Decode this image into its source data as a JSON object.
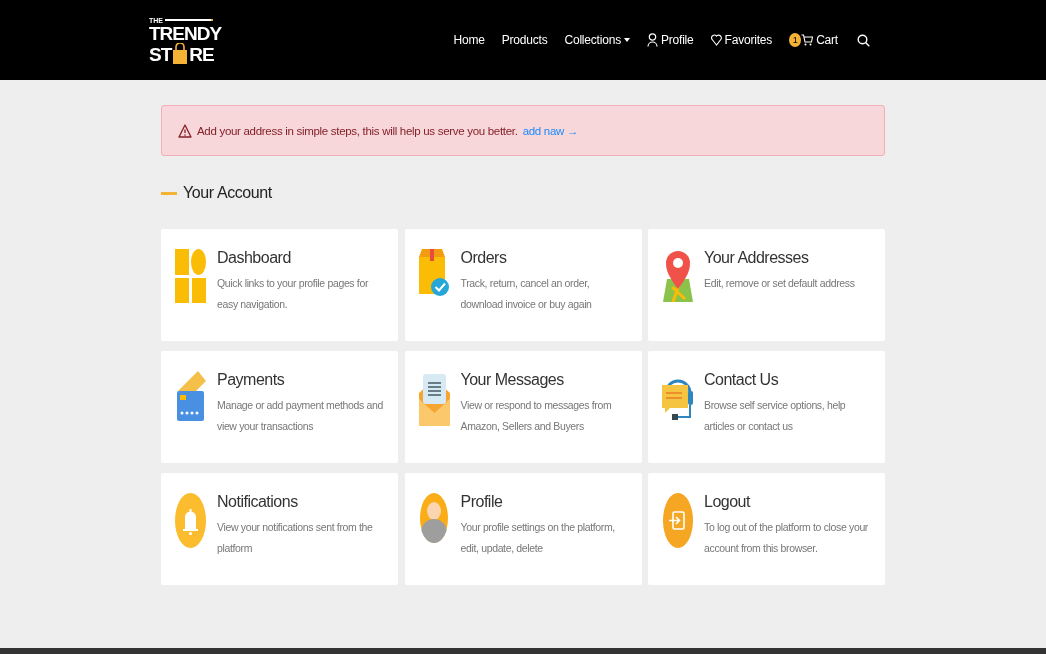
{
  "logo": {
    "top": "THE",
    "middle": "TRENDY",
    "left": "ST",
    "right": "RE"
  },
  "nav": [
    {
      "label": "Home",
      "kind": "plain"
    },
    {
      "label": "Products",
      "kind": "plain"
    },
    {
      "label": "Collections",
      "kind": "dropdown"
    },
    {
      "label": "Profile",
      "kind": "account"
    },
    {
      "label": "Favorites",
      "kind": "favorites"
    },
    {
      "label": "Cart",
      "kind": "cart",
      "badge": "1"
    }
  ],
  "alert": {
    "text": "Add your address in simple steps, this will help us serve you better.",
    "link": "add naw →"
  },
  "section_title": "Your Account",
  "cards": [
    {
      "kind": "dashboard",
      "title": "Dashboard",
      "description": "Quick links to your profile pages for easy navigation."
    },
    {
      "kind": "orders",
      "title": "Orders",
      "description": "Track, return, cancel an order, download invoice or buy again"
    },
    {
      "kind": "addresses",
      "title": "Your Addresses",
      "description": "Edit, remove or set default address"
    },
    {
      "kind": "payments",
      "title": "Payments",
      "description": "Manage or add payment methods and view your transactions"
    },
    {
      "kind": "messages",
      "title": "Your Messages",
      "description": "View or respond to messages from Amazon, Sellers and Buyers"
    },
    {
      "kind": "contact",
      "title": "Contact Us",
      "description": "Browse self service options, help articles or contact us"
    },
    {
      "kind": "notifications",
      "title": "Notifications",
      "description": "View your notifications sent from the platform"
    },
    {
      "kind": "profile",
      "title": "Profile",
      "description": "Your profile settings on the platform, edit, update, delete"
    },
    {
      "kind": "logout",
      "title": "Logout",
      "description": "To log out of the platform to close your account from this browser."
    }
  ]
}
